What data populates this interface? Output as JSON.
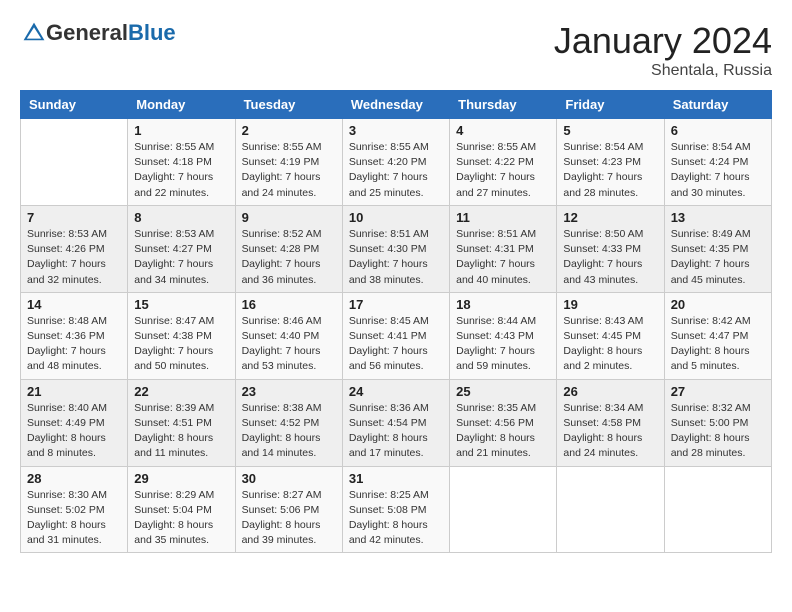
{
  "header": {
    "logo_general": "General",
    "logo_blue": "Blue",
    "month": "January 2024",
    "location": "Shentala, Russia"
  },
  "weekdays": [
    "Sunday",
    "Monday",
    "Tuesday",
    "Wednesday",
    "Thursday",
    "Friday",
    "Saturday"
  ],
  "weeks": [
    [
      {
        "day": "",
        "sunrise": "",
        "sunset": "",
        "daylight": ""
      },
      {
        "day": "1",
        "sunrise": "Sunrise: 8:55 AM",
        "sunset": "Sunset: 4:18 PM",
        "daylight": "Daylight: 7 hours and 22 minutes."
      },
      {
        "day": "2",
        "sunrise": "Sunrise: 8:55 AM",
        "sunset": "Sunset: 4:19 PM",
        "daylight": "Daylight: 7 hours and 24 minutes."
      },
      {
        "day": "3",
        "sunrise": "Sunrise: 8:55 AM",
        "sunset": "Sunset: 4:20 PM",
        "daylight": "Daylight: 7 hours and 25 minutes."
      },
      {
        "day": "4",
        "sunrise": "Sunrise: 8:55 AM",
        "sunset": "Sunset: 4:22 PM",
        "daylight": "Daylight: 7 hours and 27 minutes."
      },
      {
        "day": "5",
        "sunrise": "Sunrise: 8:54 AM",
        "sunset": "Sunset: 4:23 PM",
        "daylight": "Daylight: 7 hours and 28 minutes."
      },
      {
        "day": "6",
        "sunrise": "Sunrise: 8:54 AM",
        "sunset": "Sunset: 4:24 PM",
        "daylight": "Daylight: 7 hours and 30 minutes."
      }
    ],
    [
      {
        "day": "7",
        "sunrise": "Sunrise: 8:53 AM",
        "sunset": "Sunset: 4:26 PM",
        "daylight": "Daylight: 7 hours and 32 minutes."
      },
      {
        "day": "8",
        "sunrise": "Sunrise: 8:53 AM",
        "sunset": "Sunset: 4:27 PM",
        "daylight": "Daylight: 7 hours and 34 minutes."
      },
      {
        "day": "9",
        "sunrise": "Sunrise: 8:52 AM",
        "sunset": "Sunset: 4:28 PM",
        "daylight": "Daylight: 7 hours and 36 minutes."
      },
      {
        "day": "10",
        "sunrise": "Sunrise: 8:51 AM",
        "sunset": "Sunset: 4:30 PM",
        "daylight": "Daylight: 7 hours and 38 minutes."
      },
      {
        "day": "11",
        "sunrise": "Sunrise: 8:51 AM",
        "sunset": "Sunset: 4:31 PM",
        "daylight": "Daylight: 7 hours and 40 minutes."
      },
      {
        "day": "12",
        "sunrise": "Sunrise: 8:50 AM",
        "sunset": "Sunset: 4:33 PM",
        "daylight": "Daylight: 7 hours and 43 minutes."
      },
      {
        "day": "13",
        "sunrise": "Sunrise: 8:49 AM",
        "sunset": "Sunset: 4:35 PM",
        "daylight": "Daylight: 7 hours and 45 minutes."
      }
    ],
    [
      {
        "day": "14",
        "sunrise": "Sunrise: 8:48 AM",
        "sunset": "Sunset: 4:36 PM",
        "daylight": "Daylight: 7 hours and 48 minutes."
      },
      {
        "day": "15",
        "sunrise": "Sunrise: 8:47 AM",
        "sunset": "Sunset: 4:38 PM",
        "daylight": "Daylight: 7 hours and 50 minutes."
      },
      {
        "day": "16",
        "sunrise": "Sunrise: 8:46 AM",
        "sunset": "Sunset: 4:40 PM",
        "daylight": "Daylight: 7 hours and 53 minutes."
      },
      {
        "day": "17",
        "sunrise": "Sunrise: 8:45 AM",
        "sunset": "Sunset: 4:41 PM",
        "daylight": "Daylight: 7 hours and 56 minutes."
      },
      {
        "day": "18",
        "sunrise": "Sunrise: 8:44 AM",
        "sunset": "Sunset: 4:43 PM",
        "daylight": "Daylight: 7 hours and 59 minutes."
      },
      {
        "day": "19",
        "sunrise": "Sunrise: 8:43 AM",
        "sunset": "Sunset: 4:45 PM",
        "daylight": "Daylight: 8 hours and 2 minutes."
      },
      {
        "day": "20",
        "sunrise": "Sunrise: 8:42 AM",
        "sunset": "Sunset: 4:47 PM",
        "daylight": "Daylight: 8 hours and 5 minutes."
      }
    ],
    [
      {
        "day": "21",
        "sunrise": "Sunrise: 8:40 AM",
        "sunset": "Sunset: 4:49 PM",
        "daylight": "Daylight: 8 hours and 8 minutes."
      },
      {
        "day": "22",
        "sunrise": "Sunrise: 8:39 AM",
        "sunset": "Sunset: 4:51 PM",
        "daylight": "Daylight: 8 hours and 11 minutes."
      },
      {
        "day": "23",
        "sunrise": "Sunrise: 8:38 AM",
        "sunset": "Sunset: 4:52 PM",
        "daylight": "Daylight: 8 hours and 14 minutes."
      },
      {
        "day": "24",
        "sunrise": "Sunrise: 8:36 AM",
        "sunset": "Sunset: 4:54 PM",
        "daylight": "Daylight: 8 hours and 17 minutes."
      },
      {
        "day": "25",
        "sunrise": "Sunrise: 8:35 AM",
        "sunset": "Sunset: 4:56 PM",
        "daylight": "Daylight: 8 hours and 21 minutes."
      },
      {
        "day": "26",
        "sunrise": "Sunrise: 8:34 AM",
        "sunset": "Sunset: 4:58 PM",
        "daylight": "Daylight: 8 hours and 24 minutes."
      },
      {
        "day": "27",
        "sunrise": "Sunrise: 8:32 AM",
        "sunset": "Sunset: 5:00 PM",
        "daylight": "Daylight: 8 hours and 28 minutes."
      }
    ],
    [
      {
        "day": "28",
        "sunrise": "Sunrise: 8:30 AM",
        "sunset": "Sunset: 5:02 PM",
        "daylight": "Daylight: 8 hours and 31 minutes."
      },
      {
        "day": "29",
        "sunrise": "Sunrise: 8:29 AM",
        "sunset": "Sunset: 5:04 PM",
        "daylight": "Daylight: 8 hours and 35 minutes."
      },
      {
        "day": "30",
        "sunrise": "Sunrise: 8:27 AM",
        "sunset": "Sunset: 5:06 PM",
        "daylight": "Daylight: 8 hours and 39 minutes."
      },
      {
        "day": "31",
        "sunrise": "Sunrise: 8:25 AM",
        "sunset": "Sunset: 5:08 PM",
        "daylight": "Daylight: 8 hours and 42 minutes."
      },
      {
        "day": "",
        "sunrise": "",
        "sunset": "",
        "daylight": ""
      },
      {
        "day": "",
        "sunrise": "",
        "sunset": "",
        "daylight": ""
      },
      {
        "day": "",
        "sunrise": "",
        "sunset": "",
        "daylight": ""
      }
    ]
  ]
}
